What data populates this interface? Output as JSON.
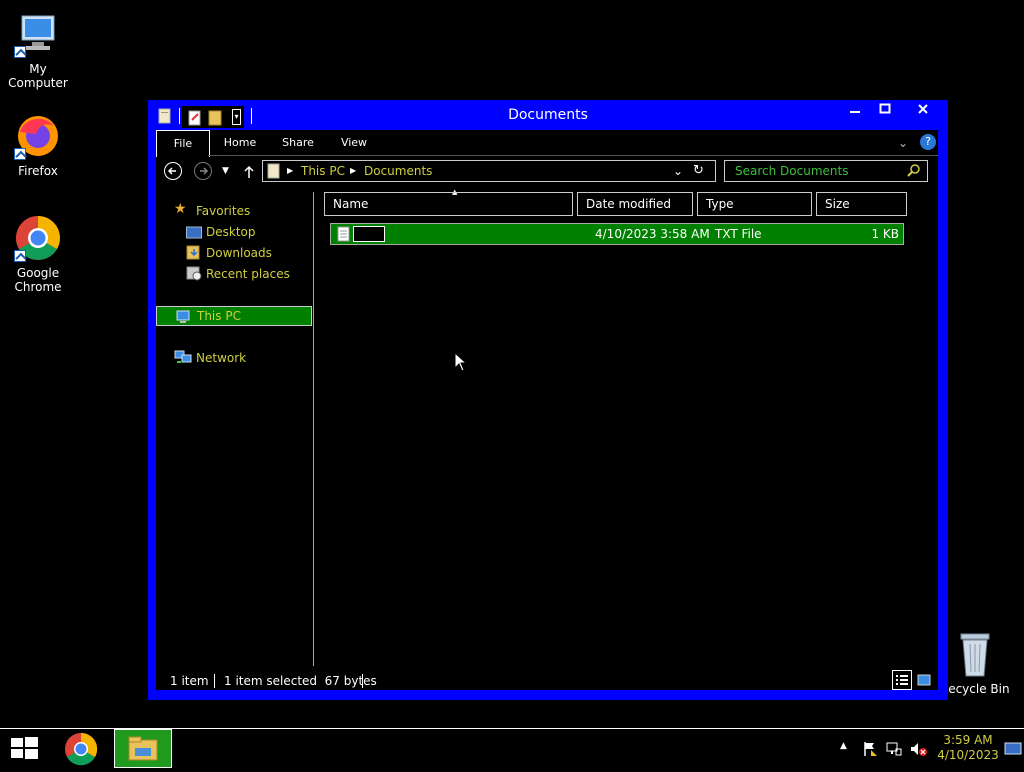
{
  "desktop": {
    "icons": [
      {
        "label": "My Computer",
        "icon": "computer-icon"
      },
      {
        "label": "Firefox",
        "icon": "firefox-icon"
      },
      {
        "label": "Google Chrome",
        "icon": "chrome-icon"
      },
      {
        "label": "Recycle Bin",
        "icon": "recycle-bin-icon"
      }
    ]
  },
  "window": {
    "title": "Documents",
    "controls": {
      "minimize": "▁",
      "maximize": "☐",
      "close": "✕"
    },
    "ribbon": {
      "tabs": [
        "File",
        "Home",
        "Share",
        "View"
      ]
    },
    "address": {
      "segments": [
        "This PC",
        "Documents"
      ]
    },
    "search": {
      "placeholder": "Search Documents"
    },
    "nav": {
      "favorites": "Favorites",
      "favorites_items": [
        "Desktop",
        "Downloads",
        "Recent places"
      ],
      "this_pc": "This PC",
      "network": "Network"
    },
    "columns": [
      "Name",
      "Date modified",
      "Type",
      "Size"
    ],
    "files": [
      {
        "name": "",
        "date": "4/10/2023 3:58 AM",
        "type": "TXT File",
        "size": "1 KB"
      }
    ],
    "status": {
      "items": "1 item",
      "selected": "1 item selected  67 bytes"
    }
  },
  "taskbar": {
    "time": "3:59 AM",
    "date": "4/10/2023"
  },
  "colors": {
    "accent": "#0000ff",
    "selection": "#008000",
    "nav_text": "#cfcf40",
    "search_text": "#3fbf3f"
  }
}
